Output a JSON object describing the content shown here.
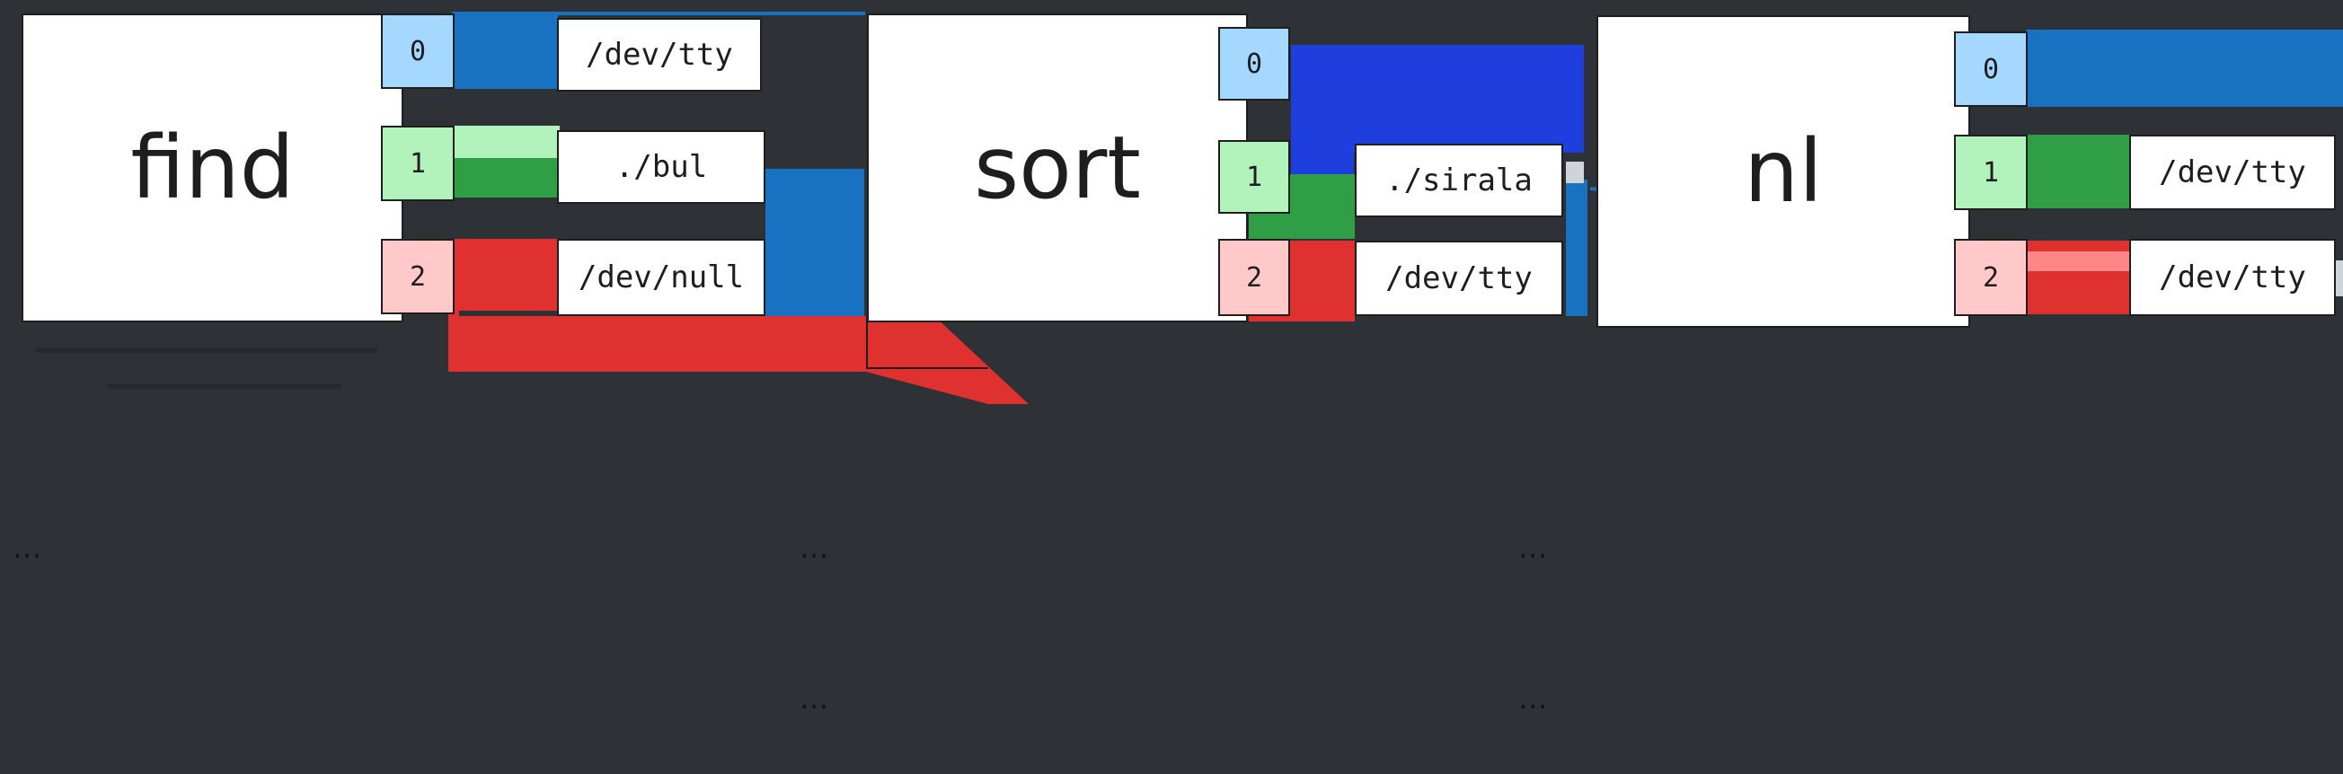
{
  "colors": {
    "background": "#2e3236",
    "stdin": "#a5d8ff",
    "stdout": "#b2f2bb",
    "stderr": "#ffc9c9",
    "blue_stroke": "#1971c2",
    "green_stroke": "#2f9e44",
    "red_stroke": "#e03131"
  },
  "processes": [
    {
      "name": "find",
      "fds": [
        {
          "num": "0",
          "target": "/dev/tty"
        },
        {
          "num": "1",
          "target": "./bul"
        },
        {
          "num": "2",
          "target": "/dev/null"
        }
      ],
      "caption": [
        "...",
        ""
      ]
    },
    {
      "name": "sort",
      "fds": [
        {
          "num": "0",
          "target": ""
        },
        {
          "num": "1",
          "target": "./sirala"
        },
        {
          "num": "2",
          "target": "/dev/tty"
        }
      ],
      "caption": [
        "...",
        "..."
      ]
    },
    {
      "name": "nl",
      "fds": [
        {
          "num": "0",
          "target": ""
        },
        {
          "num": "1",
          "target": "/dev/tty"
        },
        {
          "num": "2",
          "target": "/dev/tty"
        }
      ],
      "caption": [
        "...",
        "..."
      ]
    }
  ]
}
